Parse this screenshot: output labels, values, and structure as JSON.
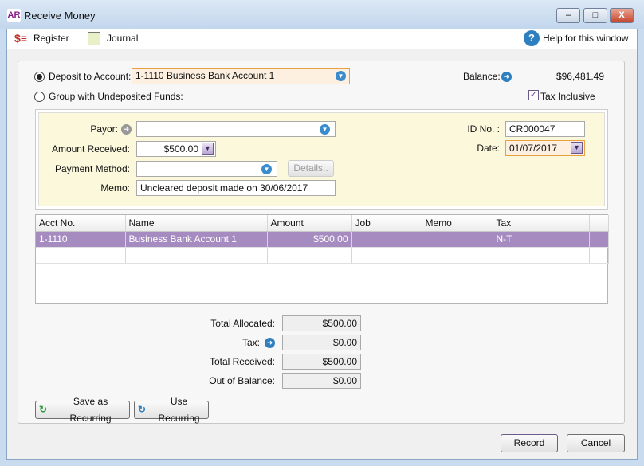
{
  "window": {
    "app_badge": "AR",
    "title": "Receive Money",
    "minimize": "–",
    "maximize": "□",
    "close": "X"
  },
  "toolbar": {
    "register": "Register",
    "journal": "Journal",
    "help": "Help for this window"
  },
  "deposit": {
    "deposit_label": "Deposit to Account:",
    "deposit_selected": true,
    "account": "1-1110 Business Bank Account 1",
    "group_label": "Group with Undeposited Funds:",
    "balance_label": "Balance:",
    "balance": "$96,481.49",
    "tax_inclusive_label": "Tax Inclusive",
    "tax_inclusive": true
  },
  "form": {
    "payor_label": "Payor:",
    "payor": "",
    "amount_label": "Amount Received:",
    "amount": "$500.00",
    "method_label": "Payment Method:",
    "method": "",
    "details": "Details..",
    "memo_label": "Memo:",
    "memo": "Uncleared deposit made on 30/06/2017",
    "id_label": "ID No. :",
    "id": "CR000047",
    "date_label": "Date:",
    "date": "01/07/2017"
  },
  "table": {
    "columns": [
      "Acct No.",
      "Name",
      "Amount",
      "Job",
      "Memo",
      "Tax"
    ],
    "rows": [
      {
        "acct": "1-1110",
        "name": "Business Bank Account 1",
        "amount": "$500.00",
        "job": "",
        "memo": "",
        "tax": "N-T"
      }
    ]
  },
  "totals": {
    "allocated_label": "Total Allocated:",
    "allocated": "$500.00",
    "tax_label": "Tax:",
    "tax": "$0.00",
    "received_label": "Total Received:",
    "received": "$500.00",
    "oob_label": "Out of Balance:",
    "oob": "$0.00"
  },
  "buttons": {
    "save_recurring": "Save as Recurring",
    "use_recurring": "Use Recurring",
    "record": "Record",
    "cancel": "Cancel"
  },
  "colors": {
    "selected_row": "#a68bc0",
    "form_panel": "#fbf8dc",
    "focus_field": "#fdf0e0"
  }
}
